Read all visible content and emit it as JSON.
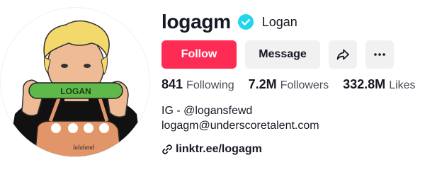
{
  "profile": {
    "username": "logagm",
    "nickname": "Logan",
    "avatar_icon": "avatar-illustration-icon",
    "verified_icon": "verified-badge-icon"
  },
  "actions": {
    "follow_label": "Follow",
    "message_label": "Message",
    "share_icon": "share-arrow-icon",
    "more_icon": "more-options-icon"
  },
  "stats": {
    "following_count": "841",
    "following_label": "Following",
    "followers_count": "7.2M",
    "followers_label": "Followers",
    "likes_count": "332.8M",
    "likes_label": "Likes"
  },
  "bio": {
    "line1": "IG - @logansfewd",
    "line2": "logagm@underscoretalent.com"
  },
  "link": {
    "icon": "link-icon",
    "text": "linktr.ee/logagm"
  },
  "avatar_art": {
    "sign_text": "LOGAN",
    "apron_text": "lalaland"
  },
  "colors": {
    "accent": "#fe2c55",
    "verified": "#20d5ec",
    "button_secondary": "#f1f1f2",
    "text_primary": "#161823",
    "text_secondary": "#494b54"
  }
}
